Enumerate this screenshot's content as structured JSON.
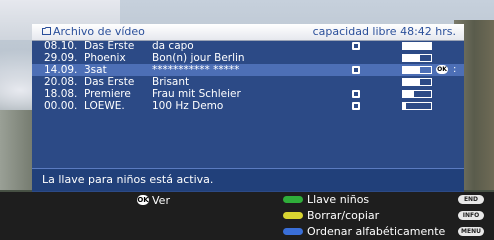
{
  "header": {
    "title": "Archivo de vídeo",
    "free_space": "capacidad libre 48:42 hrs."
  },
  "recordings": [
    {
      "time": "08.10.",
      "channel": "Das Erste",
      "title": "da capo",
      "icon": "play-icon",
      "progress": 1.0,
      "selected": false
    },
    {
      "time": "29.09.",
      "channel": "Phoenix",
      "title": "Bon(n) jour Berlin",
      "icon": "",
      "progress": 0.6,
      "selected": false
    },
    {
      "time": "14.09.",
      "channel": "3sat",
      "title": "*********** *****",
      "icon": "lock-icon",
      "progress": 0.6,
      "selected": true
    },
    {
      "time": "20.08.",
      "channel": "Das Erste",
      "title": "Brisant",
      "icon": "",
      "progress": 0.6,
      "selected": false
    },
    {
      "time": "18.08.",
      "channel": "Premiere",
      "title": "Frau mit Schleier",
      "icon": "key-icon",
      "progress": 0.4,
      "selected": false
    },
    {
      "time": "00.00.",
      "channel": "LOEWE.",
      "title": "100 Hz Demo",
      "icon": "lock-icon",
      "progress": 0.1,
      "selected": false
    }
  ],
  "status": "La llave para niños está activa.",
  "footer": {
    "ok_label": "OK",
    "view_label": "Ver",
    "actions": [
      {
        "label": "Llave niños",
        "color": "#2fae3a",
        "key": "END"
      },
      {
        "label": "Borrar/copiar",
        "color": "#d8d431",
        "key": "INFO"
      },
      {
        "label": "Ordenar alfabéticamente",
        "color": "#3a6fd8",
        "key": "MENU"
      }
    ]
  },
  "colors": {
    "panel": "#2c4a86",
    "selected_row": "#4d6fb6",
    "title_text": "#2a4f9a"
  }
}
